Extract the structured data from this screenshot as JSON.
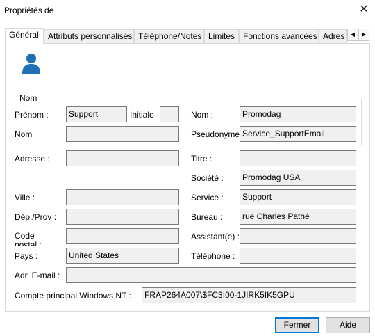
{
  "window": {
    "title": "Propriétés de",
    "close_glyph": "✕"
  },
  "tabs": [
    {
      "label": "Général"
    },
    {
      "label": "Attributs personnalisés"
    },
    {
      "label": "Téléphone/Notes"
    },
    {
      "label": "Limites"
    },
    {
      "label": "Fonctions avancées"
    },
    {
      "label": "Adres"
    }
  ],
  "tab_scroll": {
    "left": "◀",
    "right": "▶"
  },
  "name_group": {
    "title": "Nom",
    "prenom_label": "Prénom :",
    "prenom_value": "Support",
    "initiale_label": "Initiale",
    "initiale_value": "",
    "nom_label": "Nom :",
    "nom_value": "Promodag",
    "nom2_label": "Nom",
    "nom2_value": "",
    "pseudonyme_label": "Pseudonyme",
    "pseudonyme_value": "Service_SupportEmail"
  },
  "address": {
    "adresse_label": "Adresse :",
    "adresse_value": "",
    "titre_label": "Titre :",
    "titre_value": "",
    "societe_label": "Société :",
    "societe_value": "Promodag USA",
    "ville_label": "Ville :",
    "ville_value": "",
    "service_label": "Service :",
    "service_value": "Support",
    "dep_label": "Dép./Prov :",
    "dep_value": "",
    "bureau_label": "Bureau :",
    "bureau_value": "rue Charles Pathé",
    "code_label": "Code postal :",
    "code_value": "",
    "assistant_label": "Assistant(e) :",
    "assistant_value": "",
    "pays_label": "Pays :",
    "pays_value": "United States",
    "telephone_label": "Téléphone :",
    "telephone_value": "",
    "email_label": "Adr. E-mail :",
    "email_value": "",
    "nt_label": "Compte principal Windows NT :",
    "nt_value": "FRAP264A007\\$FC3I00-1JIRK5IK5GPU"
  },
  "buttons": {
    "close": "Fermer",
    "help": "Aide"
  },
  "colors": {
    "user_icon": "#1f6fb5",
    "default_button_border": "#0078d7"
  },
  "icons": {
    "user": "user-icon"
  }
}
